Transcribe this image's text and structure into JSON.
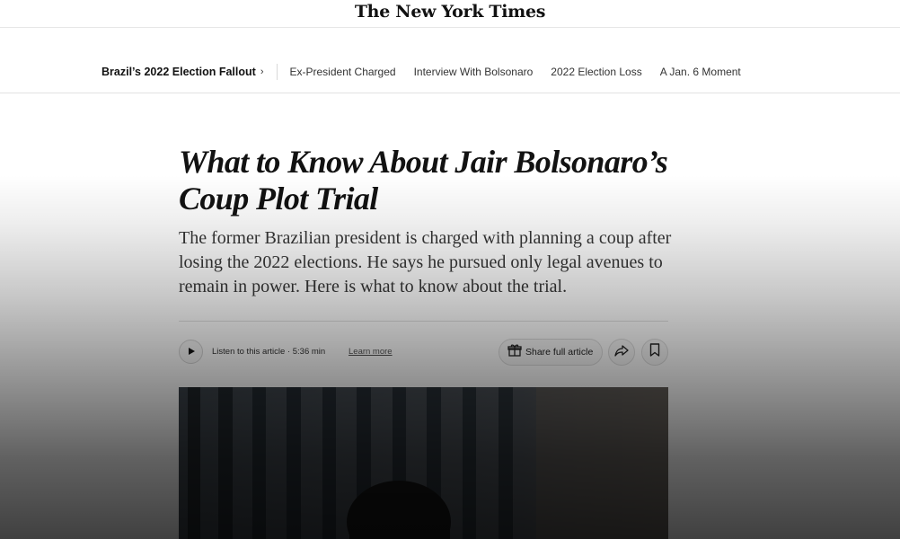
{
  "masthead": {
    "logo_text": "The New York Times"
  },
  "subnav": {
    "series_title": "Brazil’s 2022 Election Fallout",
    "chevron": "›",
    "links": [
      "Ex-President Charged",
      "Interview With Bolsonaro",
      "2022 Election Loss",
      "A Jan. 6 Moment"
    ]
  },
  "article": {
    "headline": "What to Know About Jair Bolsonaro’s Coup Plot Trial",
    "summary": "The former Brazilian president is charged with planning a coup after losing the 2022 elections. He says he pursued only legal avenues to remain in power. Here is what to know about the trial.",
    "listen_text": "Listen to this article · 5:36 min",
    "learn_more": "Learn more",
    "share_label": "Share full article"
  },
  "icons": {
    "play": "play-icon",
    "gift": "gift-icon",
    "forward": "share-arrow-icon",
    "bookmark": "bookmark-icon"
  }
}
